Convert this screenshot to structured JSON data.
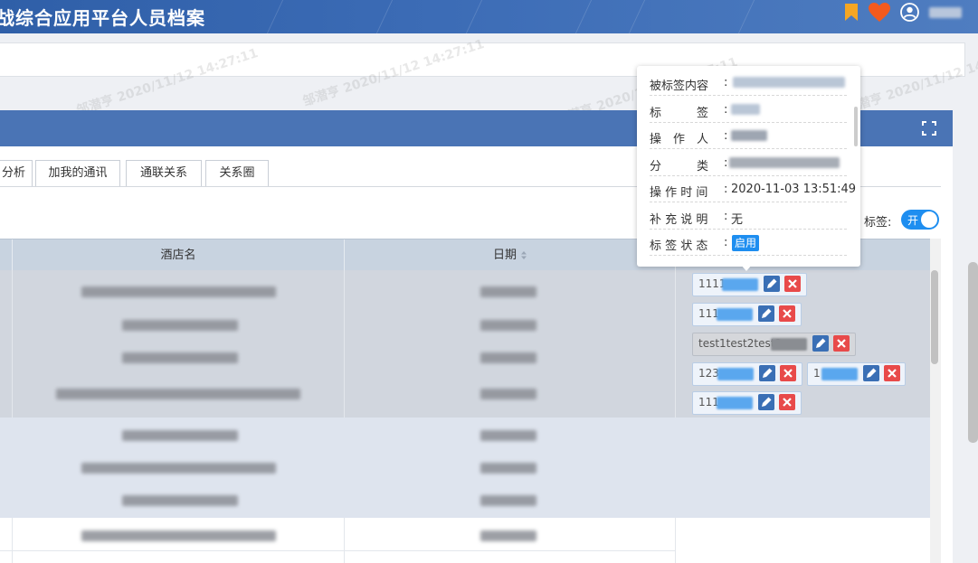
{
  "header": {
    "title": "战综合应用平台人员档案",
    "icons": [
      "bookmark-icon",
      "heart-icon",
      "user-icon"
    ]
  },
  "tabs": [
    "分析",
    "加我的通讯",
    "通联关系",
    "关系圈"
  ],
  "tag_switch": {
    "label": "标签:",
    "state": "开"
  },
  "table": {
    "columns": [
      "酒店名",
      "日期"
    ]
  },
  "tags": [
    {
      "text": "1111"
    },
    {
      "text": "111"
    },
    {
      "text": "test1test2test3"
    },
    {
      "text": "123"
    },
    {
      "text": "1"
    },
    {
      "text": "111"
    }
  ],
  "popover": {
    "rows": [
      {
        "key": "被标签内容",
        "value": ""
      },
      {
        "key": "标　　　签",
        "value": ""
      },
      {
        "key": "操　作　人",
        "value": ""
      },
      {
        "key": "分　　　类",
        "value": ""
      },
      {
        "key": "操 作 时 间",
        "value": "2020-11-03 13:51:49"
      },
      {
        "key": "补 充 说 明",
        "value": "无"
      },
      {
        "key": "标 签 状 态",
        "value": "启用"
      }
    ]
  },
  "watermark": "邹潜亨 2020/11/12 14:27:11",
  "colors": {
    "header_bg": "#3c6cb6",
    "panel_header": "#4a74b5",
    "accent": "#1e8ef0",
    "edit_button": "#3a6fb5",
    "delete_button": "#e84a4a",
    "heart": "#f25a1e",
    "bookmark": "#f5a623"
  }
}
